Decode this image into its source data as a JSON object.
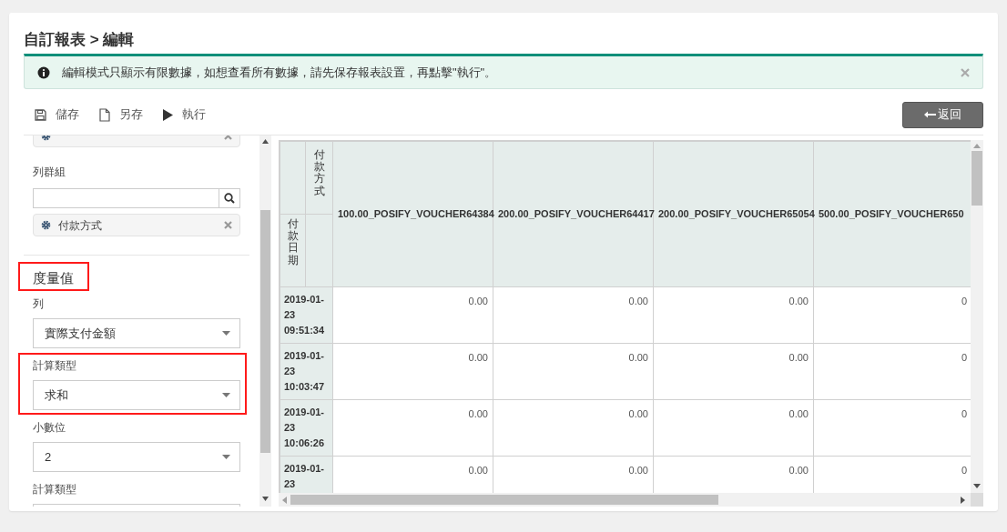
{
  "title": "自訂報表 > 編輯",
  "alert": {
    "text": "編輯模式只顯示有限數據，如想查看所有數據，請先保存報表設置，再點擊\"執行\"。"
  },
  "toolbar": [
    {
      "kind": "save",
      "label": "儲存"
    },
    {
      "kind": "file",
      "label": "另存"
    },
    {
      "kind": "play",
      "label": "執行"
    }
  ],
  "back_button": {
    "label": "返回"
  },
  "sidebar": {
    "items": [
      {
        "kind": "chip"
      },
      {
        "kind": "label",
        "text": "列群組"
      },
      {
        "kind": "search"
      },
      {
        "kind": "chip",
        "text": "付款方式"
      },
      {
        "kind": "divider"
      },
      {
        "kind": "heading",
        "text": "度量值",
        "highlighted": true
      },
      {
        "kind": "field",
        "label": "列",
        "value": "實際支付金額",
        "highlighted": false
      },
      {
        "kind": "field",
        "label": "計算類型",
        "value": "求和",
        "highlighted": true
      },
      {
        "kind": "field",
        "label": "小數位",
        "value": "2",
        "highlighted": false
      },
      {
        "kind": "field",
        "label": "計算類型",
        "highlighted": false
      }
    ]
  },
  "table": {
    "column_header": "付款方式",
    "row_header": "付款日期",
    "columns": [
      "100.00_POSIFY_VOUCHER64384",
      "200.00_POSIFY_VOUCHER64417",
      "200.00_POSIFY_VOUCHER65054",
      "500.00_POSIFY_VOUCHER650"
    ],
    "rows": [
      {
        "date": "2019-01-23 09:51:34",
        "cells": [
          "0.00",
          "0.00",
          "0.00",
          "0"
        ]
      },
      {
        "date": "2019-01-23 10:03:47",
        "cells": [
          "0.00",
          "0.00",
          "0.00",
          "0"
        ]
      },
      {
        "date": "2019-01-23 10:06:26",
        "cells": [
          "0.00",
          "0.00",
          "0.00",
          "0"
        ]
      },
      {
        "date": "2019-01-23",
        "cells": [
          "0.00",
          "0.00",
          "0.00",
          "0"
        ]
      }
    ]
  }
}
